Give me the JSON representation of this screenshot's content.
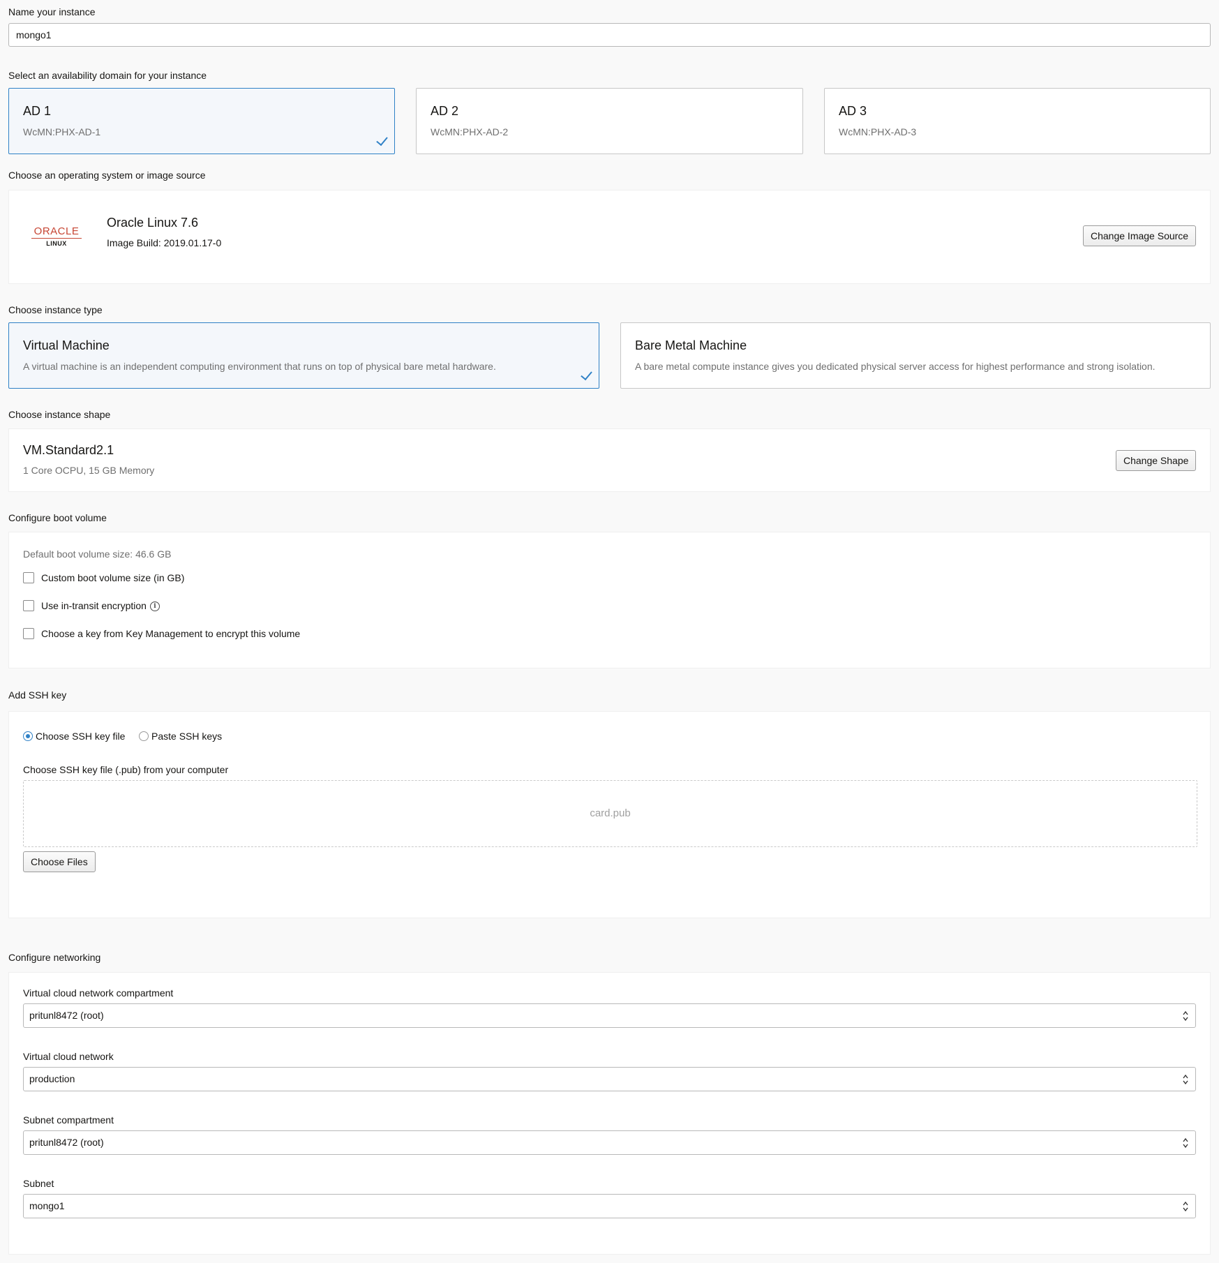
{
  "name_section": {
    "label": "Name your instance",
    "value": "mongo1"
  },
  "availability_domain": {
    "label": "Select an availability domain for your instance",
    "options": [
      {
        "title": "AD 1",
        "subtitle": "WcMN:PHX-AD-1",
        "selected": true
      },
      {
        "title": "AD 2",
        "subtitle": "WcMN:PHX-AD-2",
        "selected": false
      },
      {
        "title": "AD 3",
        "subtitle": "WcMN:PHX-AD-3",
        "selected": false
      }
    ]
  },
  "image_source": {
    "label": "Choose an operating system or image source",
    "logo_text": "ORACLE",
    "logo_subtext": "LINUX",
    "name": "Oracle Linux 7.6",
    "build": "Image Build: 2019.01.17-0",
    "change_button": "Change Image Source"
  },
  "instance_type": {
    "label": "Choose instance type",
    "options": [
      {
        "title": "Virtual Machine",
        "description": "A virtual machine is an independent computing environment that runs on top of physical bare metal hardware.",
        "selected": true
      },
      {
        "title": "Bare Metal Machine",
        "description": "A bare metal compute instance gives you dedicated physical server access for highest performance and strong isolation.",
        "selected": false
      }
    ]
  },
  "instance_shape": {
    "label": "Choose instance shape",
    "name": "VM.Standard2.1",
    "details": "1 Core OCPU, 15 GB Memory",
    "change_button": "Change Shape"
  },
  "boot_volume": {
    "label": "Configure boot volume",
    "default_size": "Default boot volume size: 46.6 GB",
    "options": [
      {
        "label": "Custom boot volume size (in GB)",
        "checked": false
      },
      {
        "label": "Use in-transit encryption",
        "checked": false,
        "info_icon": "info-icon"
      },
      {
        "label": "Choose a key from Key Management to encrypt this volume",
        "checked": false
      }
    ]
  },
  "ssh_key": {
    "label": "Add SSH key",
    "radio_options": [
      {
        "label": "Choose SSH key file",
        "selected": true
      },
      {
        "label": "Paste SSH keys",
        "selected": false
      }
    ],
    "file_label": "Choose SSH key file (.pub) from your computer",
    "dropzone_file": "card.pub",
    "choose_button": "Choose Files"
  },
  "networking": {
    "label": "Configure networking",
    "fields": [
      {
        "label": "Virtual cloud network compartment",
        "value": "pritunl8472 (root)"
      },
      {
        "label": "Virtual cloud network",
        "value": "production"
      },
      {
        "label": "Subnet compartment",
        "value": "pritunl8472 (root)"
      },
      {
        "label": "Subnet",
        "value": "mongo1"
      }
    ]
  },
  "colors": {
    "accent": "#2f81c6",
    "oracle_red": "#c74634",
    "selected_bg": "#f4f7fb"
  }
}
